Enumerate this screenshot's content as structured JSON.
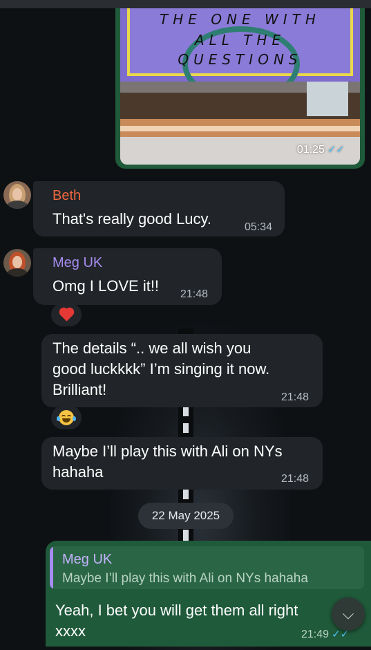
{
  "media_message": {
    "poster_lines": [
      "THE ONE WITH",
      "ALL THE",
      "QUESTIONS"
    ],
    "time": "01:25",
    "status_icon": "double-check-icon"
  },
  "messages": [
    {
      "sender": "Beth",
      "sender_color": "#f0683e",
      "text": "That's really good Lucy.",
      "time": "05:34"
    },
    {
      "sender": "Meg UK",
      "sender_color": "#a68cf0",
      "text": "Omg I LOVE it!!",
      "time": "21:48",
      "reaction": "heart"
    },
    {
      "text_lines": [
        "The details “.. we all wish you",
        "good luckkkk” I’m singing it now.",
        "Brilliant!"
      ],
      "time": "21:48",
      "reaction": "laughing-face"
    },
    {
      "text_lines": [
        "Maybe I’ll play this with Ali on NYs",
        "hahaha"
      ],
      "time": "21:48"
    }
  ],
  "date_separator": "22 May 2025",
  "outgoing": {
    "reply_to": {
      "sender": "Meg UK",
      "text": "Maybe I’ll play this with Ali on NYs hahaha"
    },
    "text_lines": [
      "Yeah, I bet you will get them all right",
      "xxxx"
    ],
    "time": "21:49",
    "status_icon": "double-check-icon"
  },
  "scroll_button": {
    "icon": "chevron-double-down-icon"
  }
}
